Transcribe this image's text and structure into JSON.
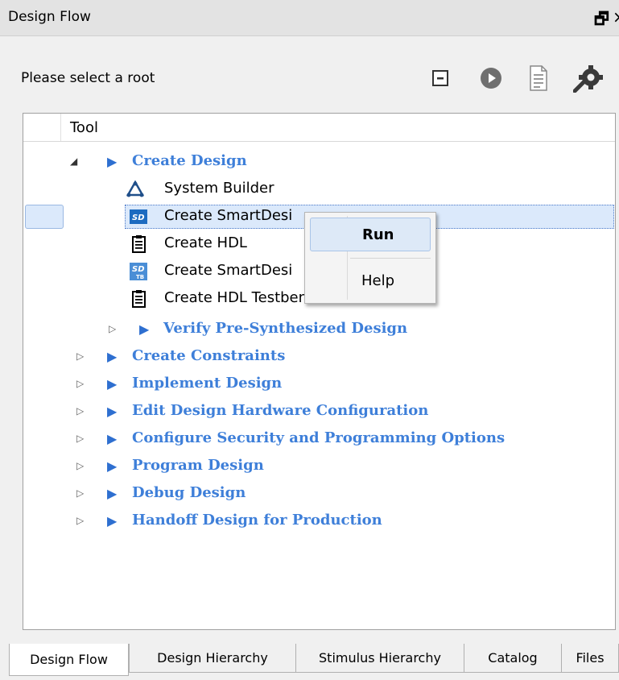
{
  "panel": {
    "title": "Design Flow"
  },
  "toolbar": {
    "root_label": "Please select a root"
  },
  "tree": {
    "column_header": "Tool",
    "create_design": {
      "label": "Create Design",
      "children": [
        {
          "label": "System Builder",
          "icon": "system-builder-icon"
        },
        {
          "label": "Create SmartDesi",
          "icon": "smartdesign-icon"
        },
        {
          "label": "Create HDL",
          "icon": "hdl-document-icon"
        },
        {
          "label": "Create SmartDesi",
          "icon": "smartdesign-testbench-icon"
        },
        {
          "label": "Create HDL Testbench",
          "icon": "hdl-document-icon"
        }
      ],
      "verify": "Verify Pre-Synthesized Design"
    },
    "categories": [
      "Create Constraints",
      "Implement Design",
      "Edit Design Hardware Configuration",
      "Configure Security and Programming Options",
      "Program Design",
      "Debug Design",
      "Handoff Design for Production"
    ]
  },
  "context_menu": {
    "run": "Run",
    "help": "Help"
  },
  "tabs": [
    "Design Flow",
    "Design Hierarchy",
    "Stimulus Hierarchy",
    "Catalog",
    "Files"
  ],
  "colors": {
    "category_text": "#3e7fd9",
    "selection": "#dbe9fb"
  }
}
